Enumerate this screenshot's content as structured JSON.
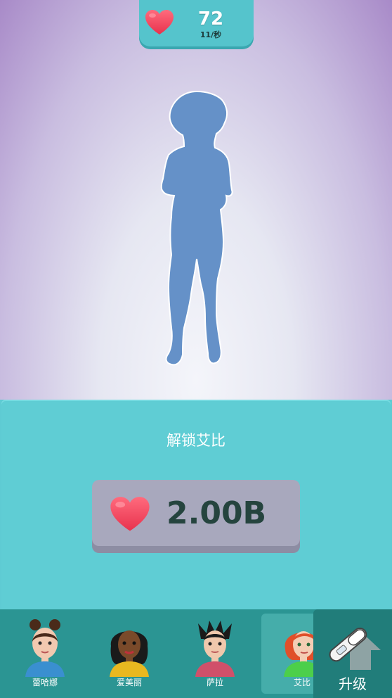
{
  "header": {
    "hearts_icon": "heart-icon",
    "hearts_count": "72",
    "hearts_rate": "11/秒"
  },
  "stage": {
    "locked_character_icon": "woman-silhouette"
  },
  "unlock_panel": {
    "title": "解锁艾比",
    "price": "2.00B",
    "price_icon": "heart-icon"
  },
  "characters": [
    {
      "name": "蕾哈娜",
      "selected": false
    },
    {
      "name": "爱美丽",
      "selected": false
    },
    {
      "name": "萨拉",
      "selected": false
    },
    {
      "name": "艾比",
      "selected": true
    }
  ],
  "upgrade": {
    "label": "升级",
    "icon": "upgrade-arrow-icon"
  },
  "colors": {
    "panel": "#5fcdd4",
    "bottom_bar": "#2b9593",
    "heart": "#f0465e",
    "silhouette": "#6591c8"
  }
}
